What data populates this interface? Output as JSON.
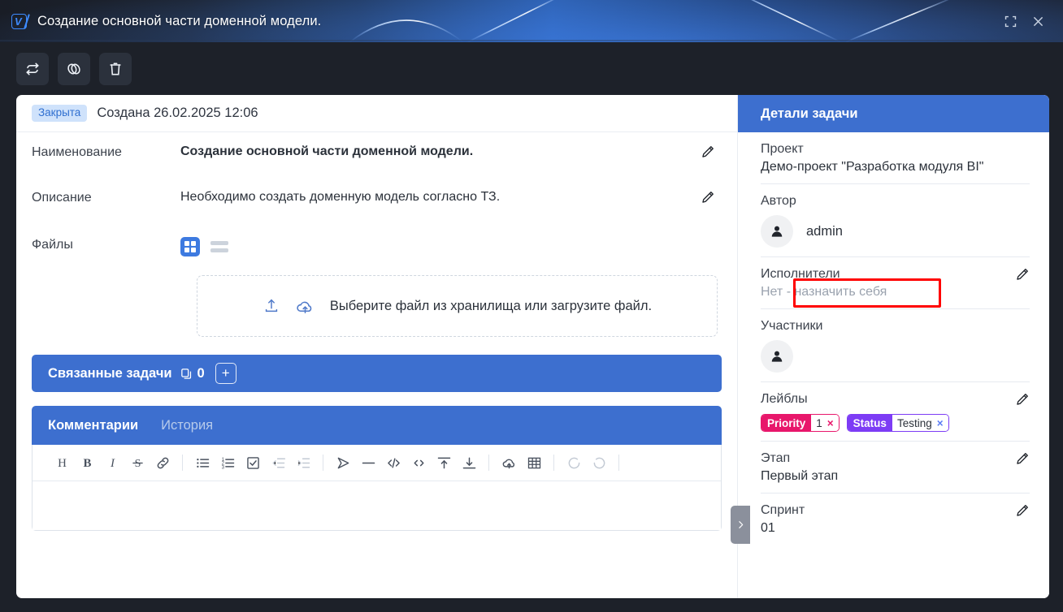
{
  "window": {
    "title": "Создание основной части доменной модели.",
    "logo_icon": "v-logo-icon",
    "fullscreen_icon": "fullscreen-icon",
    "close_icon": "close-icon"
  },
  "toolbar": {
    "refresh_icon": "refresh-icon",
    "link_icon": "link-icon",
    "delete_icon": "trash-icon"
  },
  "task": {
    "status_badge": "Закрыта",
    "created": "Создана 26.02.2025 12:06",
    "fields": {
      "name_label": "Наименование",
      "name_value": "Создание основной части доменной модели.",
      "description_label": "Описание",
      "description_value": "Необходимо создать доменную модель согласно ТЗ.",
      "files_label": "Файлы"
    },
    "dropzone_text": "Выберите файл из хранилища или загрузите файл.",
    "related": {
      "title": "Связанные задачи",
      "count": "0",
      "add_label": "+"
    },
    "tabs": [
      {
        "label": "Комментарии",
        "active": true
      },
      {
        "label": "История",
        "active": false
      }
    ]
  },
  "editor": {
    "items": [
      {
        "name": "heading-icon",
        "glyph": "H",
        "dim": false
      },
      {
        "name": "bold-icon",
        "glyph": "B",
        "dim": false
      },
      {
        "name": "italic-icon",
        "glyph": "I",
        "dim": false
      },
      {
        "name": "strikethrough-icon",
        "glyph": "S̶",
        "dim": false
      },
      {
        "name": "link-icon",
        "glyph": "🔗",
        "dim": false
      },
      {
        "name": "separator",
        "glyph": "|",
        "dim": false
      },
      {
        "name": "bullet-list-icon",
        "glyph": "☰",
        "dim": false
      },
      {
        "name": "numbered-list-icon",
        "glyph": "☰",
        "dim": false
      },
      {
        "name": "checklist-icon",
        "glyph": "☑",
        "dim": false
      },
      {
        "name": "outdent-icon",
        "glyph": "⇤",
        "dim": true
      },
      {
        "name": "indent-icon",
        "glyph": "⇥",
        "dim": true
      },
      {
        "name": "separator",
        "glyph": "|",
        "dim": false
      },
      {
        "name": "blockquote-icon",
        "glyph": "▷",
        "dim": false
      },
      {
        "name": "horizontal-rule-icon",
        "glyph": "—",
        "dim": false
      },
      {
        "name": "code-block-icon",
        "glyph": "</>",
        "dim": false
      },
      {
        "name": "inline-code-icon",
        "glyph": "<>",
        "dim": false
      },
      {
        "name": "insert-above-icon",
        "glyph": "↥",
        "dim": false
      },
      {
        "name": "insert-below-icon",
        "glyph": "↧",
        "dim": false
      },
      {
        "name": "separator",
        "glyph": "|",
        "dim": false
      },
      {
        "name": "upload-cloud-icon",
        "glyph": "☁",
        "dim": false
      },
      {
        "name": "table-icon",
        "glyph": "▦",
        "dim": false
      },
      {
        "name": "separator",
        "glyph": "|",
        "dim": false
      },
      {
        "name": "undo-icon",
        "glyph": "↺",
        "dim": true
      },
      {
        "name": "redo-icon",
        "glyph": "↻",
        "dim": true
      },
      {
        "name": "separator",
        "glyph": "|",
        "dim": false
      }
    ]
  },
  "collapse_handle": {
    "icon": "chevron-right-icon"
  },
  "details": {
    "header": "Детали задачи",
    "project_label": "Проект",
    "project_value": "Демо-проект \"Разработка модуля BI\"",
    "author_label": "Автор",
    "author_name": "admin",
    "assignees_label": "Исполнители",
    "assignees_value": "Нет - назначить себя",
    "participants_label": "Участники",
    "labels_label": "Лейблы",
    "labels": [
      {
        "key": "Priority",
        "value": "1",
        "key_color": "#e8176b",
        "x_color": "#e8176b"
      },
      {
        "key": "Status",
        "value": "Testing",
        "key_color": "#7d3cf5",
        "x_color": "#5b7cf5"
      }
    ],
    "stage_label": "Этап",
    "stage_value": "Первый этап",
    "sprint_label": "Спринт",
    "sprint_value": "01",
    "edit_icon": "pencil-icon"
  },
  "highlight": {
    "name": "assignee-highlight-box",
    "color": "#ff0000"
  }
}
